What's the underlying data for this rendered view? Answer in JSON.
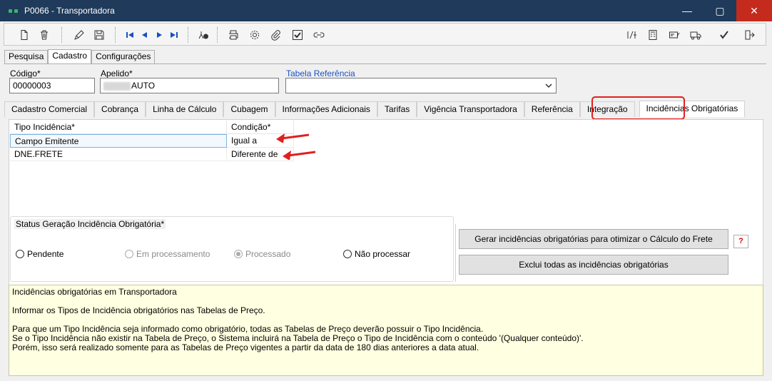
{
  "window": {
    "title": "P0066 - Transportadora",
    "minimize": "—",
    "maximize": "▢",
    "close": "✕"
  },
  "toolbar_icons": [
    "new-doc-icon",
    "delete-icon",
    "edit-icon",
    "save-icon",
    "first-record-icon",
    "prev-record-icon",
    "next-record-icon",
    "last-record-icon",
    "search-icon",
    "print-icon",
    "settings-icon",
    "attach-icon",
    "check-icon",
    "link-icon",
    "formula-icon",
    "calculator-icon",
    "card-icon",
    "truck-icon",
    "confirm-icon",
    "exit-icon"
  ],
  "top_tabs": [
    "Pesquisa",
    "Cadastro",
    "Configurações"
  ],
  "form": {
    "codigo_label": "Código*",
    "codigo_value": "00000003",
    "apelido_label": "Apelido*",
    "apelido_value": "AUTO",
    "tabela_label": "Tabela Referência",
    "tabela_value": ""
  },
  "main_tabs": [
    "Cadastro Comercial",
    "Cobrança",
    "Linha de Cálculo",
    "Cubagem",
    "Informações Adicionais",
    "Tarifas",
    "Vigência Transportadora",
    "Referência",
    "Integração",
    "Incidências Obrigatórias"
  ],
  "grid": {
    "headers": [
      "Tipo Incidência*",
      "Condição*"
    ],
    "rows": [
      {
        "tipo": "Campo Emitente",
        "condicao": "Igual a"
      },
      {
        "tipo": "DNE.FRETE",
        "condicao": "Diferente de"
      }
    ]
  },
  "status": {
    "label": "Status Geração Incidência Obrigatória*",
    "options": [
      "Pendente",
      "Em processamento",
      "Processado",
      "Não processar"
    ],
    "selected": "Processado"
  },
  "buttons": {
    "gerar": "Gerar incidências obrigatórias para otimizar o Cálculo do Frete",
    "excluir": "Exclui todas as incidências obrigatórias",
    "help": "?"
  },
  "info": {
    "lines": [
      "Incidências obrigatórias em Transportadora",
      "",
      "Informar os Tipos de Incidência obrigatórios nas Tabelas de Preço.",
      "",
      "Para que um Tipo Incidência seja informado como obrigatório, todas as Tabelas de Preço deverão possuir o Tipo Incidência.",
      "Se o Tipo Incidência não existir na Tabela de Preço, o Sistema incluirá na Tabela de Preço o Tipo de Incidência com o conteúdo '(Qualquer conteúdo)'.",
      "Porém, isso será realizado somente para as Tabelas de Preço vigentes a partir da data de 180 dias anteriores a data atual."
    ]
  },
  "colors": {
    "titlebar": "#1f3a5a",
    "close": "#c42b1c",
    "highlight": "#e02020",
    "info_bg": "#ffffe1"
  }
}
